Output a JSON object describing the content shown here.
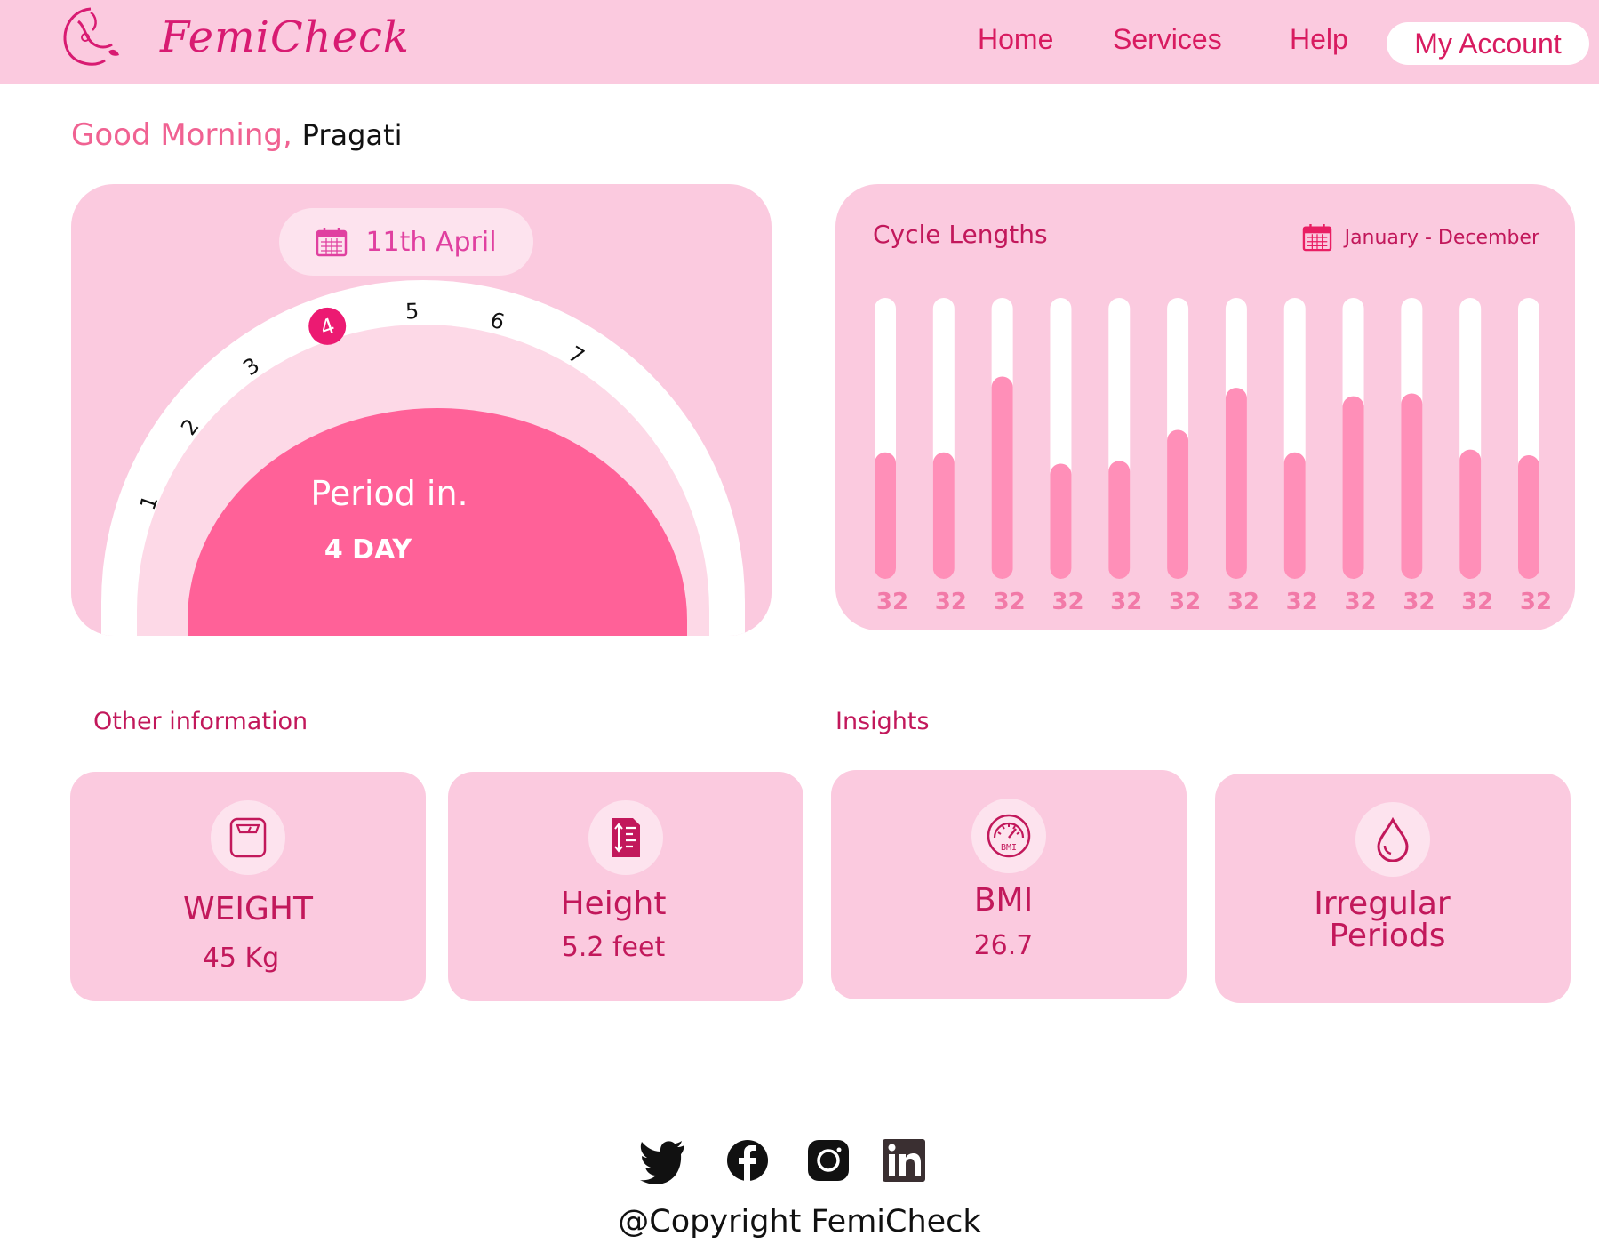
{
  "header": {
    "brand": "FemiCheck",
    "nav": {
      "home": "Home",
      "services": "Services",
      "help": "Help",
      "account": "My Account"
    }
  },
  "greeting": {
    "hello": "Good Morning,",
    "name": "Pragati"
  },
  "cycle": {
    "date": "11th April",
    "day_numbers": [
      "1",
      "2",
      "3",
      "4",
      "5",
      "6",
      "7"
    ],
    "current_day": 4,
    "period_label": "Period in.",
    "period_days": "4 DAY"
  },
  "cycle_chart": {
    "title": "Cycle Lengths",
    "range": "January - December"
  },
  "chart_data": {
    "type": "bar",
    "title": "Cycle Lengths",
    "subtitle": "January - December",
    "labels": [
      "32",
      "32",
      "32",
      "32",
      "32",
      "32",
      "32",
      "32",
      "32",
      "32",
      "32",
      "32"
    ],
    "fill_fraction": [
      0.45,
      0.45,
      0.72,
      0.41,
      0.42,
      0.53,
      0.68,
      0.45,
      0.65,
      0.66,
      0.46,
      0.44
    ]
  },
  "sections": {
    "other": "Other information",
    "insights": "Insights"
  },
  "cards": {
    "weight": {
      "title": "WEIGHT",
      "value": "45 Kg"
    },
    "height": {
      "title": "Height",
      "value": "5.2 feet"
    },
    "bmi": {
      "title": "BMI",
      "value": "26.7",
      "icon_text": "BMI"
    },
    "irregular": {
      "title_line1": "Irregular",
      "title_line2": "Periods"
    }
  },
  "footer": {
    "copyright": "@Copyright FemiCheck"
  },
  "colors": {
    "header_bg": "#fbcadf",
    "accent": "#c2185b",
    "period_fill": "#ff6198",
    "bar_fill": "#ff8fb8",
    "current_day": "#ec1a72"
  }
}
